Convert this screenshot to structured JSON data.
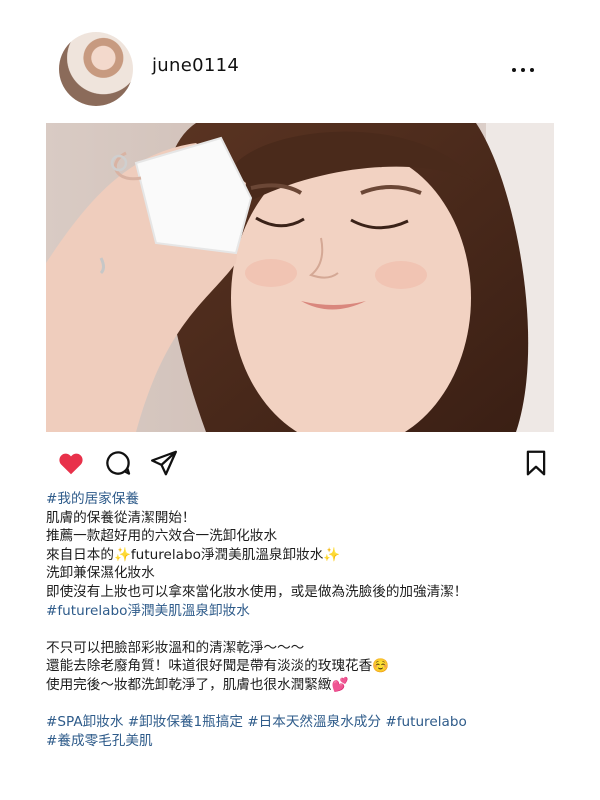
{
  "post": {
    "username": "june0114",
    "colors": {
      "like": "#e8314a",
      "hashtag": "#2e5b8a"
    }
  },
  "actions": {
    "like_icon": "heart-filled",
    "comment_icon": "speech-bubble",
    "share_icon": "paper-plane",
    "save_icon": "bookmark"
  },
  "caption": {
    "lines": [
      "#我的居家保養",
      "肌膚的保養從清潔開始！",
      "推薦一款超好用的六效合一洗卸化妝水",
      "來自日本的✨futurelabo淨潤美肌溫泉卸妝水✨",
      "洗卸兼保濕化妝水",
      "即使沒有上妝也可以拿來當化妝水使用，或是做為洗臉後的加強清潔！",
      "#futurelabo淨潤美肌溫泉卸妝水",
      "",
      "不只可以把臉部彩妝溫和的清潔乾淨～～～",
      "還能去除老廢角質！味道很好聞是帶有淡淡的玫瑰花香☺️",
      "使用完後～妝都洗卸乾淨了，肌膚也很水潤緊緻💕",
      "",
      "#SPA卸妝水 #卸妝保養1瓶搞定 #日本天然溫泉水成分 #futurelabo",
      "#養成零毛孔美肌"
    ]
  }
}
